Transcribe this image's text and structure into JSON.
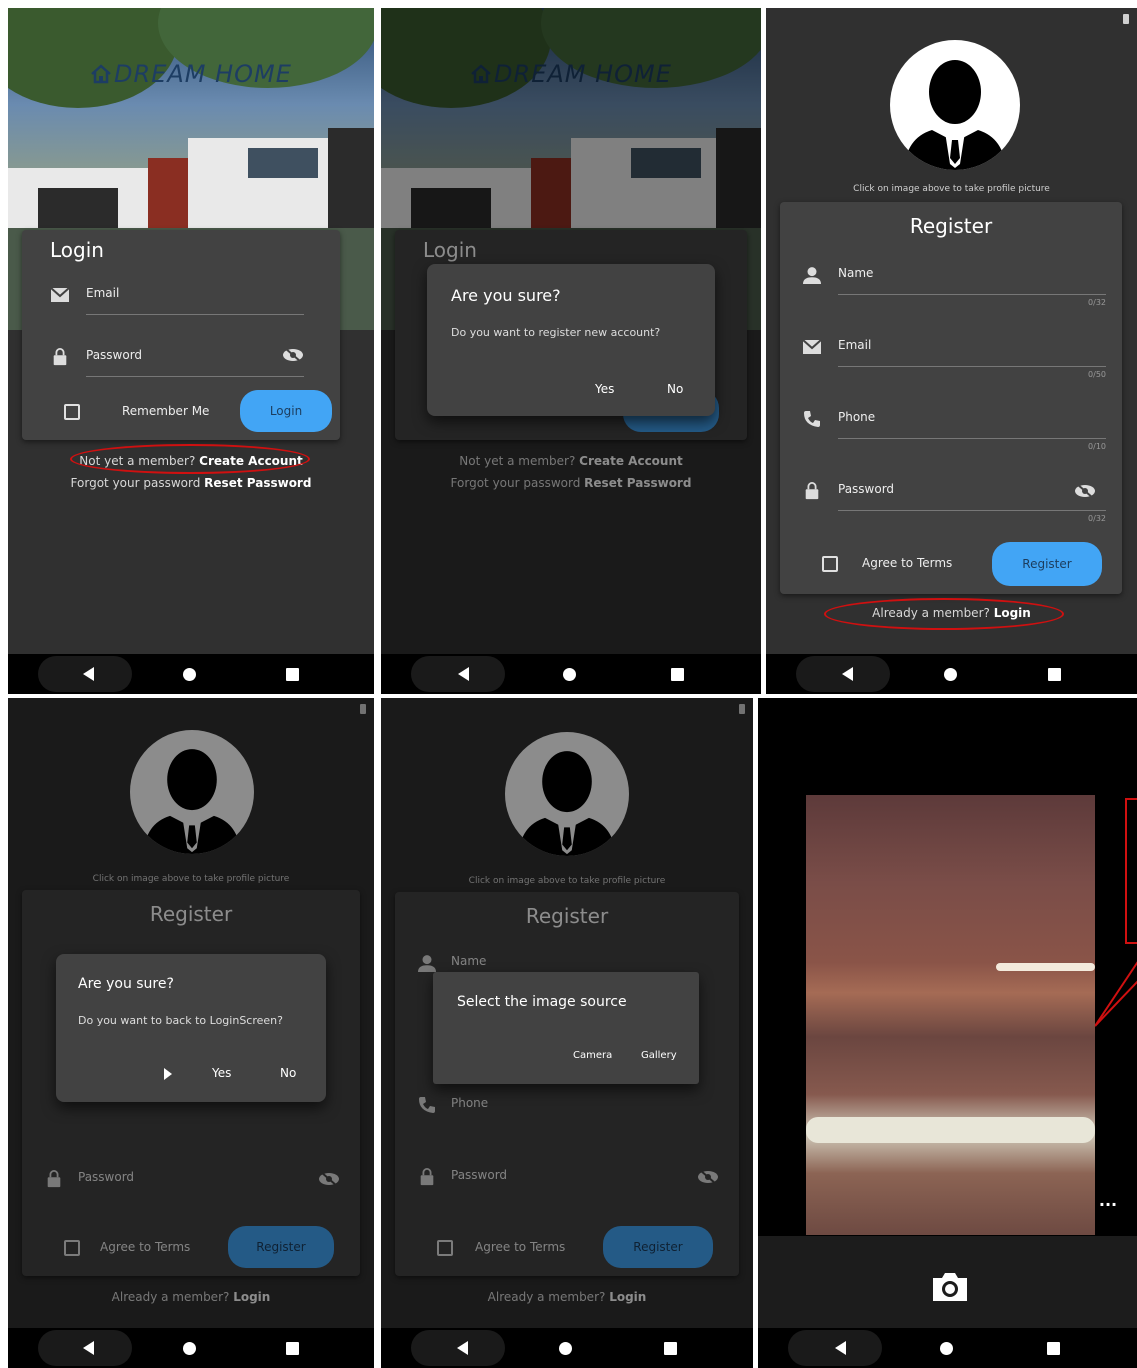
{
  "login": {
    "brand": "DREAM HOME",
    "title": "Login",
    "email_label": "Email",
    "password_label": "Password",
    "remember_label": "Remember Me",
    "login_button": "Login",
    "signup_prompt": "Not yet a member?",
    "signup_link": "Create Account",
    "reset_prompt": "Forgot your password",
    "reset_link": "Reset Password"
  },
  "register_dialog": {
    "title": "Are you sure?",
    "message": "Do you want to register new account?",
    "yes": "Yes",
    "no": "No"
  },
  "register": {
    "caption": "Click on image above to take profile picture",
    "title": "Register",
    "name_label": "Name",
    "name_counter": "0/32",
    "email_label": "Email",
    "email_counter": "0/50",
    "phone_label": "Phone",
    "phone_counter": "0/10",
    "password_label": "Password",
    "password_counter": "0/32",
    "agree_label": "Agree to Terms",
    "register_button": "Register",
    "login_prompt": "Already a member?",
    "login_link": "Login"
  },
  "back_dialog": {
    "title": "Are you sure?",
    "message": "Do you want to back to LoginScreen?",
    "yes": "Yes",
    "no": "No"
  },
  "image_source_dialog": {
    "title": "Select the image source",
    "camera": "Camera",
    "gallery": "Gallery"
  },
  "camera": {
    "more": "..."
  },
  "colors": {
    "accent": "#42a5f5",
    "annotation": "#d01010",
    "background": "#303030",
    "card": "#424242"
  }
}
